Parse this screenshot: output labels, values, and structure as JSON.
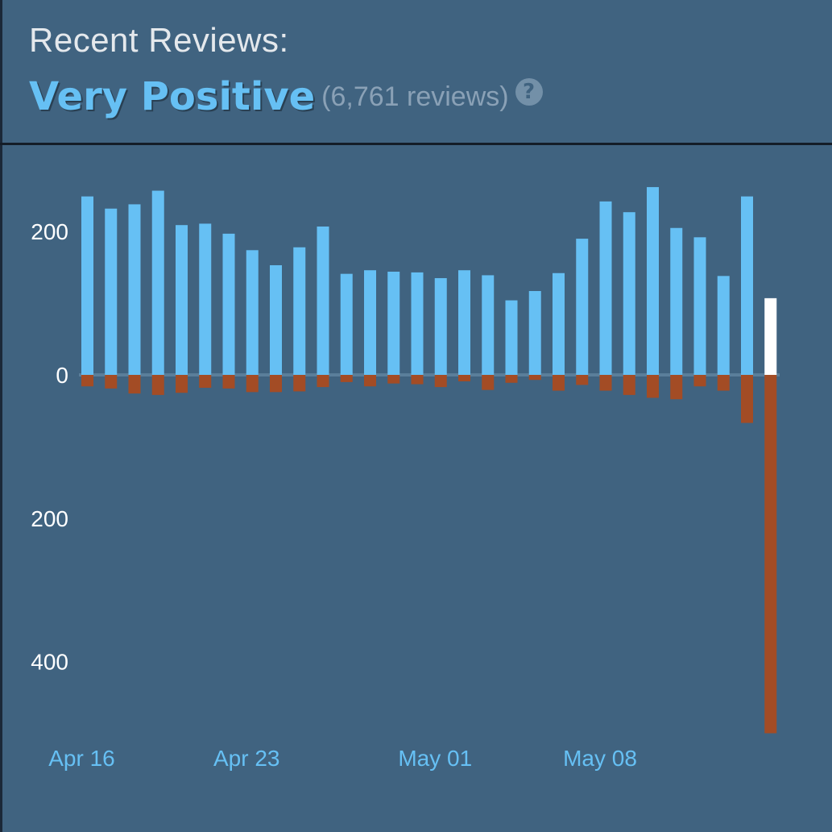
{
  "header": {
    "title": "Recent Reviews:",
    "summary": "Very Positive",
    "count_text": "(6,761 reviews)",
    "help_symbol": "?"
  },
  "colors": {
    "positive": "#66c0f4",
    "negative": "#a34c25",
    "today_positive": "#ffffff",
    "background": "#406380",
    "summary": "#66c0f4"
  },
  "chart_data": {
    "type": "bar",
    "x_tick_labels": [
      "Apr 16",
      "Apr 23",
      "May 01",
      "May 08"
    ],
    "y_tick_labels_positive": [
      "200",
      "0"
    ],
    "y_tick_labels_negative": [
      "200",
      "400"
    ],
    "ylim": [
      -500,
      260
    ],
    "grid": false,
    "series": [
      {
        "values": [
          249,
          232,
          238,
          257,
          209,
          211,
          197,
          174,
          153,
          178,
          207,
          141,
          146,
          144,
          143,
          135,
          146,
          139,
          104,
          117,
          142,
          190,
          242,
          227,
          262,
          205,
          192,
          138,
          249,
          107
        ]
      },
      {
        "values": [
          -16,
          -19,
          -26,
          -28,
          -25,
          -18,
          -19,
          -24,
          -24,
          -23,
          -17,
          -10,
          -16,
          -12,
          -13,
          -17,
          -9,
          -21,
          -11,
          -7,
          -22,
          -14,
          -22,
          -28,
          -32,
          -34,
          -16,
          -22,
          -67,
          -500
        ]
      }
    ]
  }
}
